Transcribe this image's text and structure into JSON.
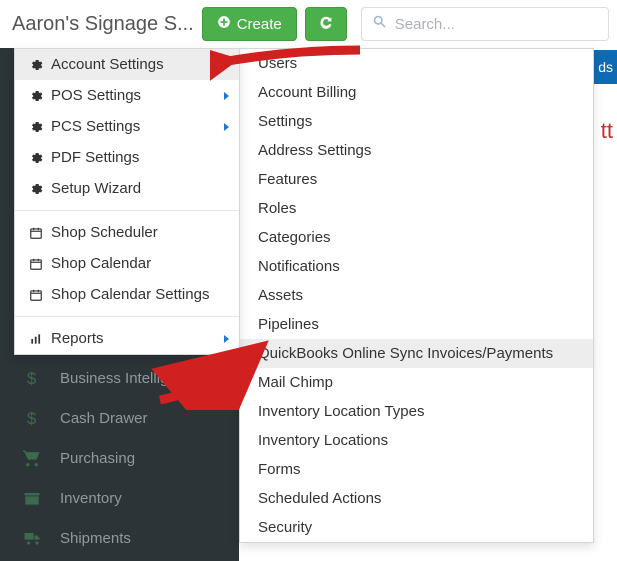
{
  "header": {
    "shop_name": "Aaron's Signage S...",
    "create_label": "Create",
    "search_placeholder": "Search...",
    "blue_strip_text": "ds"
  },
  "right_red_label": "tt",
  "settings_menu": {
    "items": [
      {
        "label": "Account Settings",
        "icon": "cog",
        "arrow": false,
        "hover": true
      },
      {
        "label": "POS Settings",
        "icon": "cog",
        "arrow": true
      },
      {
        "label": "PCS Settings",
        "icon": "cog",
        "arrow": true
      },
      {
        "label": "PDF Settings",
        "icon": "cog",
        "arrow": false
      },
      {
        "label": "Setup Wizard",
        "icon": "cog",
        "arrow": false
      }
    ],
    "schedule_items": [
      {
        "label": "Shop Scheduler"
      },
      {
        "label": "Shop Calendar"
      },
      {
        "label": "Shop Calendar Settings"
      }
    ],
    "reports": {
      "label": "Reports"
    }
  },
  "submenu": {
    "items": [
      "Users",
      "Account Billing",
      "Settings",
      "Address Settings",
      "Features",
      "Roles",
      "Categories",
      "Notifications",
      "Assets",
      "Pipelines",
      "QuickBooks Online Sync Invoices/Payments",
      "Mail Chimp",
      "Inventory Location Types",
      "Inventory Locations",
      "Forms",
      "Scheduled Actions",
      "Security"
    ],
    "hover_index": 10
  },
  "rail": {
    "items": [
      {
        "label": "Business Intelligence",
        "icon": "dollar"
      },
      {
        "label": "Cash Drawer",
        "icon": "dollar"
      },
      {
        "label": "Purchasing",
        "icon": "cart"
      },
      {
        "label": "Inventory",
        "icon": "box"
      },
      {
        "label": "Shipments",
        "icon": "truck"
      }
    ]
  }
}
